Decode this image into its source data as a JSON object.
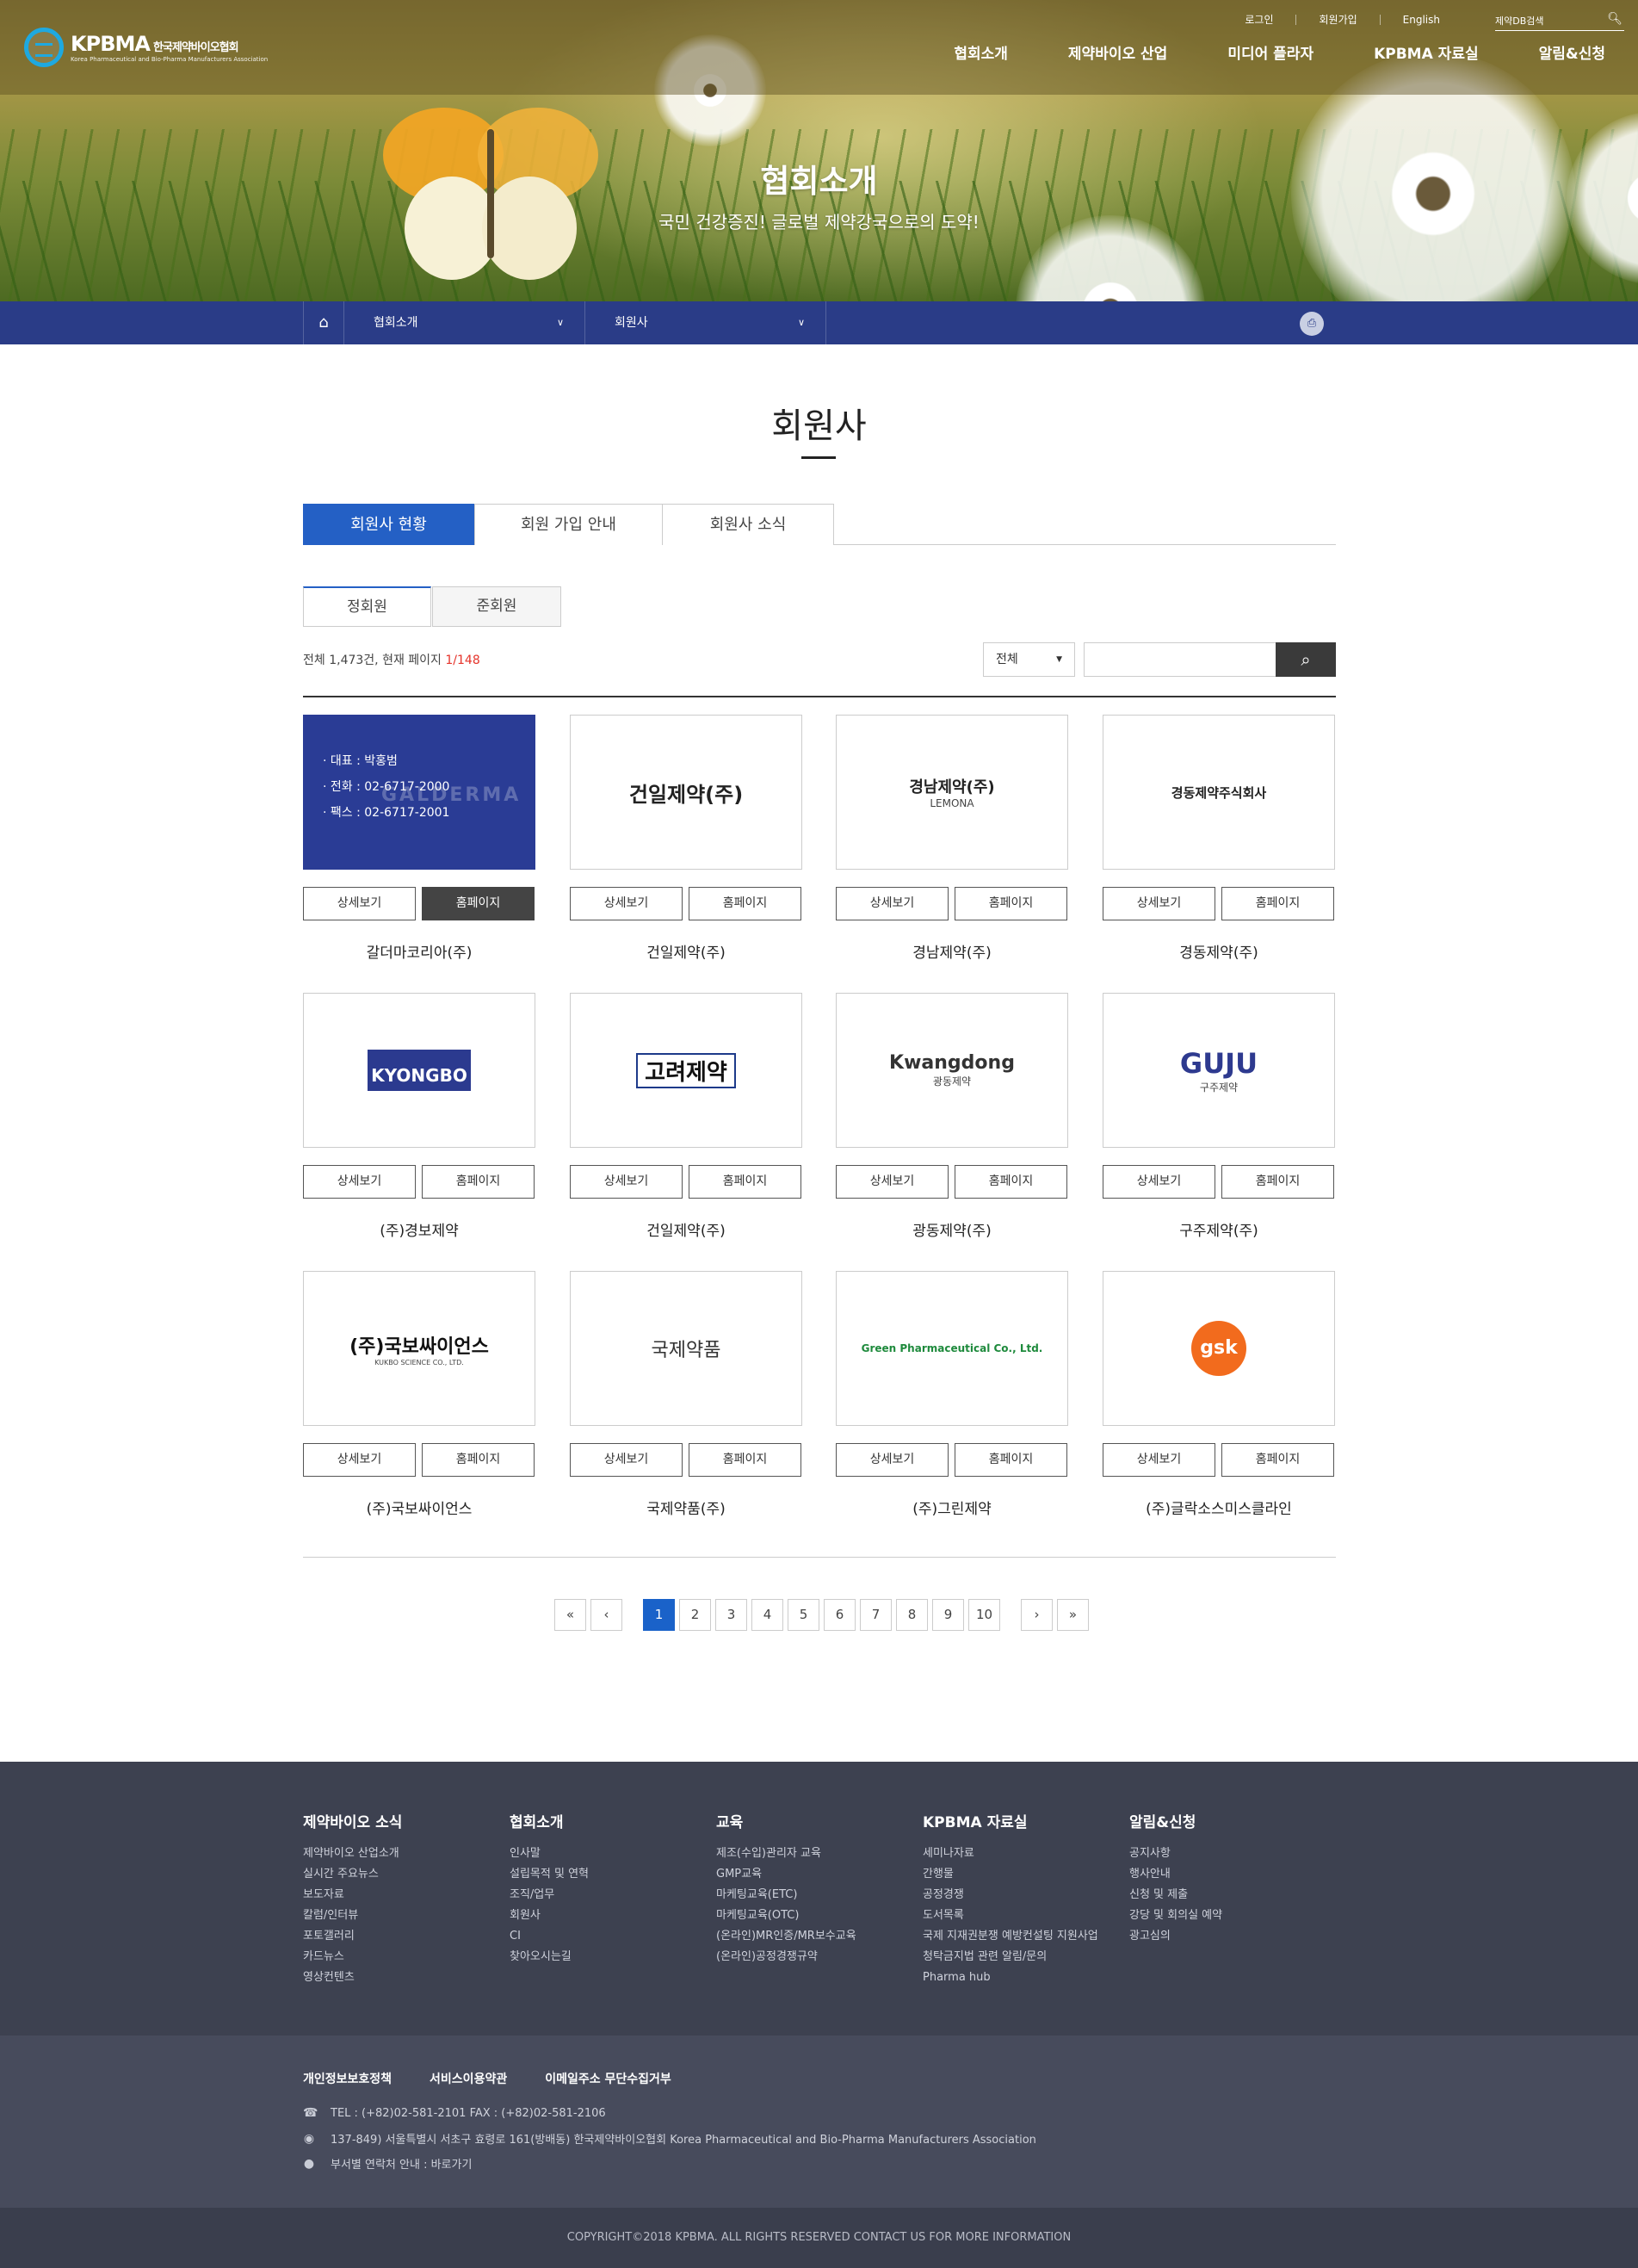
{
  "header": {
    "logo_text": "KPBMA",
    "logo_korean": "한국제약바이오협회",
    "logo_english": "Korea Pharmaceutical and Bio-Pharma Manufacturers Association",
    "util": [
      "로그인",
      "회원가입",
      "English"
    ],
    "search_label": "제약DB검색",
    "gnb": [
      "협회소개",
      "제약바이오 산업",
      "미디어 플라자",
      "KPBMA 자료실",
      "알림&신청"
    ]
  },
  "hero": {
    "title": "협회소개",
    "subtitle": "국민 건강증진! 글로벌 제약강국으로의 도약!"
  },
  "lnb": {
    "depth1": "협회소개",
    "depth2": "회원사"
  },
  "page_title": "회원사",
  "tabs": [
    "회원사 현황",
    "회원 가입 안내",
    "회원사 소식"
  ],
  "subtabs": [
    "정회원",
    "준회원"
  ],
  "count": {
    "text": "전체 1,473건, 현재 페이지 ",
    "page": "1/148"
  },
  "search": {
    "select": "전체"
  },
  "card_buttons": {
    "detail": "상세보기",
    "home": "홈페이지"
  },
  "first_card_info": {
    "rep": "· 대표 : 박홍범",
    "tel": "· 전화 : 02-6717-2000",
    "fax": "· 팩스 : 02-6717-2001",
    "ghost": "GALDERMA"
  },
  "members": [
    {
      "name": "갈더마코리아(주)",
      "logo": ""
    },
    {
      "name": "건일제약(주)",
      "logo": "건일제약(주)"
    },
    {
      "name": "경남제약(주)",
      "logo": "경남제약(주)",
      "logo_sub": "LEMONA"
    },
    {
      "name": "경동제약(주)",
      "logo": "경동제약주식회사"
    },
    {
      "name": "(주)경보제약",
      "logo": "KYONGBO"
    },
    {
      "name": "건일제약(주)",
      "logo": "고려제약"
    },
    {
      "name": "광동제약(주)",
      "logo": "Kwangdong",
      "logo_sub": "광동제약"
    },
    {
      "name": "구주제약(주)",
      "logo": "GUJU",
      "logo_sub": "구주제약"
    },
    {
      "name": "(주)국보싸이언스",
      "logo": "(주)국보싸이언스",
      "logo_sub": "KUKBO SCIENCE CO., LTD."
    },
    {
      "name": "국제약품(주)",
      "logo": "국제약품"
    },
    {
      "name": "(주)그린제약",
      "logo": "Green Pharmaceutical Co., Ltd."
    },
    {
      "name": "(주)글락소스미스클라인",
      "logo": "gsk"
    }
  ],
  "pager": [
    "1",
    "2",
    "3",
    "4",
    "5",
    "6",
    "7",
    "8",
    "9",
    "10"
  ],
  "footer": {
    "cols": [
      {
        "title": "제약바이오 소식",
        "items": [
          "제약바이오 산업소개",
          "실시간 주요뉴스",
          "보도자료",
          "칼럼/인터뷰",
          "포토갤러리",
          "카드뉴스",
          "영상컨텐츠"
        ]
      },
      {
        "title": "협회소개",
        "items": [
          "인사말",
          "설립목적 및 연혁",
          "조직/업무",
          "회원사",
          "CI",
          "찾아오시는길"
        ]
      },
      {
        "title": "교육",
        "items": [
          "제조(수입)관리자 교육",
          "GMP교육",
          "마케팅교육(ETC)",
          "마케팅교육(OTC)",
          "(온라인)MR인증/MR보수교육",
          "(온라인)공정경쟁규약"
        ]
      },
      {
        "title": "KPBMA 자료실",
        "items": [
          "세미나자료",
          "간행물",
          "공정경쟁",
          "도서목록",
          "국제 지재권분쟁 예방컨설팅 지원사업",
          "청탁금지법 관련 알림/문의",
          "Pharma hub"
        ]
      },
      {
        "title": "알림&신청",
        "items": [
          "공지사항",
          "행사안내",
          "신청 및 제출",
          "강당 및 회의실 예약",
          "광고심의"
        ]
      }
    ],
    "links": [
      "개인정보보호정책",
      "서비스이용약관",
      "이메일주소 무단수집거부"
    ],
    "tel": "TEL : (+82)02-581-2101   FAX : (+82)02-581-2106",
    "address": "137-849) 서울특별시 서초구 효령로 161(방배동) 한국제약바이오협회 Korea Pharmaceutical and Bio-Pharma Manufacturers Association",
    "dept": "부서별 연락처 안내 : 바로가기",
    "copyright": "COPYRIGHT©2018 KPBMA. ALL RIGHTS RESERVED CONTACT US FOR MORE INFORMATION"
  }
}
